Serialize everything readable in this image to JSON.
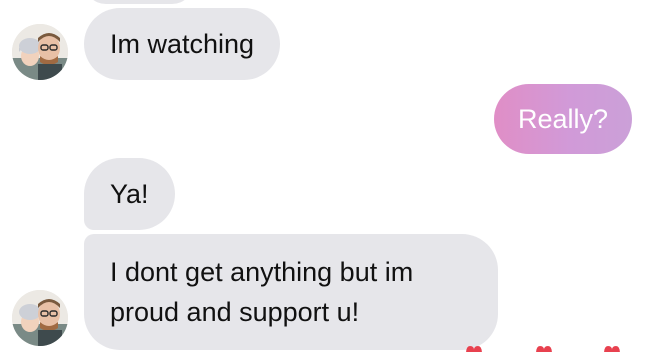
{
  "thread": {
    "messages": [
      {
        "id": "m1",
        "sender": "peer",
        "text": "Im watching"
      },
      {
        "id": "m2",
        "sender": "me",
        "text": "Really?"
      },
      {
        "id": "m3",
        "sender": "peer",
        "text": "Ya!"
      },
      {
        "id": "m4",
        "sender": "peer",
        "text": "I dont get anything but im proud and support u!"
      }
    ]
  },
  "colors": {
    "peer_bubble": "#e6e6ea",
    "my_bubble_start": "#e08ec6",
    "my_bubble_end": "#cba0d8",
    "heart": "#e8414f"
  },
  "icons": {
    "avatar": "contact-avatar-photo",
    "reaction": "heart-icon"
  }
}
